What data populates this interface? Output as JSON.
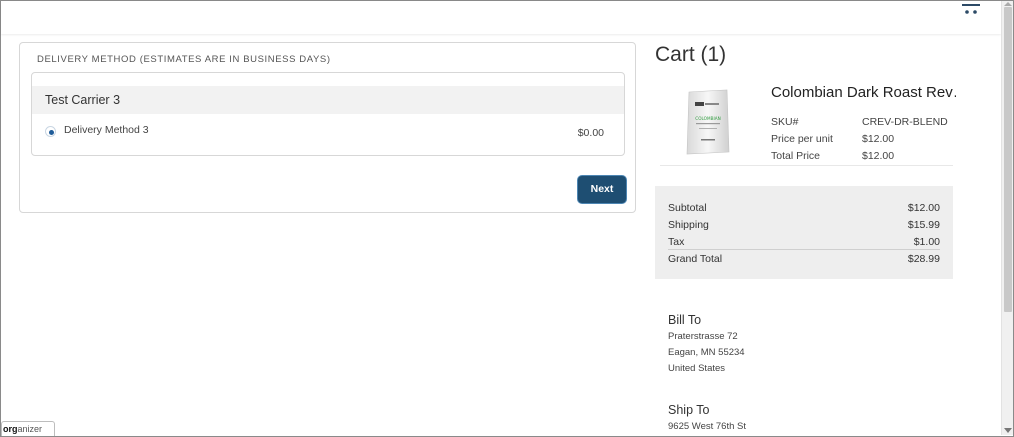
{
  "header": {
    "cart_icon": "cart-icon"
  },
  "delivery": {
    "title": "DELIVERY METHOD (ESTIMATES ARE IN BUSINESS DAYS)",
    "carrier": "Test Carrier 3",
    "method": {
      "label": "Delivery Method 3",
      "price": "$0.00",
      "selected": true
    },
    "next_label": "Next"
  },
  "cart": {
    "title": "Cart (1)",
    "product": {
      "name": "Colombian Dark Roast Rev…",
      "sku_label": "SKU#",
      "sku": "CREV-DR-BLEND",
      "price_per_unit_label": "Price per unit",
      "price_per_unit": "$12.00",
      "total_price_label": "Total Price",
      "total_price": "$12.00",
      "package_text": "COLOMBIAN"
    },
    "totals": {
      "subtotal_label": "Subtotal",
      "subtotal": "$12.00",
      "shipping_label": "Shipping",
      "shipping": "$15.99",
      "tax_label": "Tax",
      "tax": "$1.00",
      "grand_total_label": "Grand Total",
      "grand_total": "$28.99"
    },
    "bill_to": {
      "heading": "Bill To",
      "line1": "Praterstrasse 72",
      "line2": "Eagan, MN 55234",
      "line3": "United States"
    },
    "ship_to": {
      "heading": "Ship To",
      "line1": "9625 West 76th St"
    }
  },
  "organizer": {
    "bold": "org",
    "rest": "anizer"
  },
  "colors": {
    "accent": "#1e4e72",
    "radio": "#1f5c99",
    "totals_bg": "#eeeeee"
  }
}
